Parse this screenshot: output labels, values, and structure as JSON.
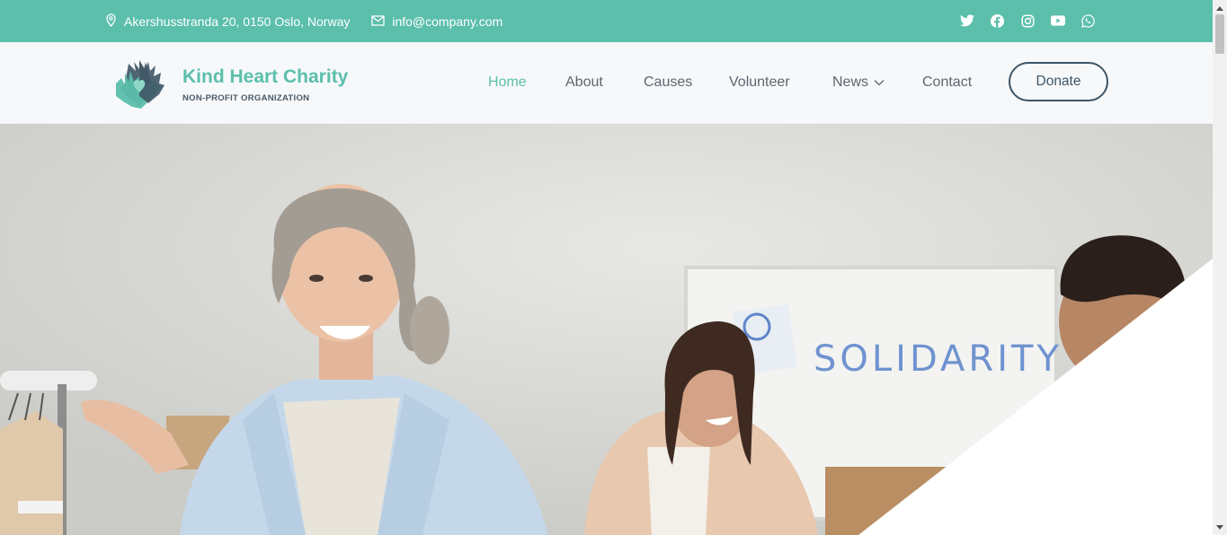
{
  "topbar": {
    "address": "Akershusstranda 20, 0150 Oslo, Norway",
    "email": "info@company.com",
    "socials": [
      "twitter-icon",
      "facebook-icon",
      "instagram-icon",
      "youtube-icon",
      "whatsapp-icon"
    ]
  },
  "brand": {
    "title": "Kind Heart Charity",
    "subtitle": "NON-PROFIT ORGANIZATION"
  },
  "nav": {
    "items": [
      {
        "label": "Home",
        "active": true
      },
      {
        "label": "About"
      },
      {
        "label": "Causes"
      },
      {
        "label": "Volunteer"
      },
      {
        "label": "News",
        "has_dropdown": true
      },
      {
        "label": "Contact"
      }
    ],
    "donate_label": "Donate"
  },
  "hero": {
    "whiteboard_text": "SOLIDARITY"
  },
  "colors": {
    "accent": "#5bbfab",
    "dark": "#3d5566",
    "nav_text": "#5c6670"
  }
}
